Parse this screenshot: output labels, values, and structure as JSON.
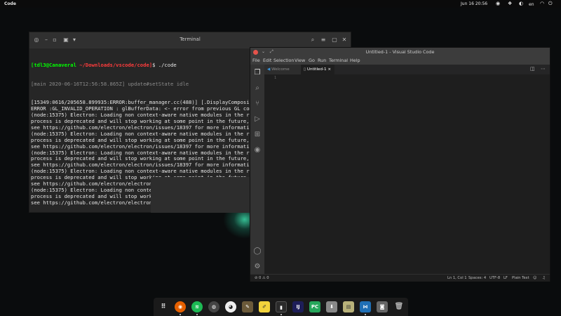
{
  "topbar": {
    "app_name": "Code",
    "clock": "Jun 16  20:56",
    "language": "en"
  },
  "terminal": {
    "title": "Terminal",
    "prompt_user": "[tdl3@Canaveral",
    "prompt_path": "~/Downloads/vscode/code]",
    "prompt_cmd": "$ ./code",
    "line_main": "[main 2020-06-16T12:56:58.865Z] update#setState idle",
    "lines": [
      "[15349:0616/205658.899935:ERROR:buffer_manager.cc(488)] [.DisplayCompositor",
      "ERROR :GL_INVALID_OPERATION : glBufferData: <- error from previous GL command",
      "(node:15375) Electron: Loading non context-aware native modules in the rende",
      "process is deprecated and will stop working at some point in the future, ple",
      "see https://github.com/electron/electron/issues/18397 for more information",
      "(node:15375) Electron: Loading non context-aware native modules in the rende",
      "process is deprecated and will stop working at some point in the future, ple",
      "see https://github.com/electron/electron/issues/18397 for more information",
      "(node:15375) Electron: Loading non context-aware native modules in the rende",
      "process is deprecated and will stop working at some point in the future, ple",
      "see https://github.com/electron/electron/issues/18397 for more information",
      "(node:15375) Electron: Loading non context-aware native modules in the rende",
      "process is deprecated and will stop working at some point in the future, ple",
      "see https://github.com/electron/electron/issues/18397 for more information",
      "(node:15375) Electron: Loading non context-aware native modules in the rende",
      "process is deprecated and will stop working at some point in the future, ple",
      "see https://github.com/electron/electron/issues/18397 for more information"
    ]
  },
  "vscode": {
    "title": "Untitled-1 - Visual Studio Code",
    "menu": [
      "File",
      "Edit",
      "Selection",
      "View",
      "Go",
      "Run",
      "Terminal",
      "Help"
    ],
    "tabs": {
      "welcome": "Welcome",
      "untitled": "Untitled-1",
      "close": "×"
    },
    "line_number": "1",
    "status": {
      "problems": "⊘ 0  ⚠ 0",
      "position": "Ln 1, Col 1",
      "spaces": "Spaces: 4",
      "encoding": "UTF-8",
      "eol": "LF",
      "language": "Plain Text"
    }
  },
  "dock": {
    "icons": [
      "apps-grid-icon",
      "firefox-icon",
      "spotify-icon",
      "obs-icon",
      "github-icon",
      "gimp-icon",
      "notes-icon",
      "terminal-icon",
      "intellij-icon",
      "pycharm-icon",
      "downloader-icon",
      "files-icon",
      "vscode-icon",
      "document-viewer-icon",
      "trash-icon"
    ]
  }
}
